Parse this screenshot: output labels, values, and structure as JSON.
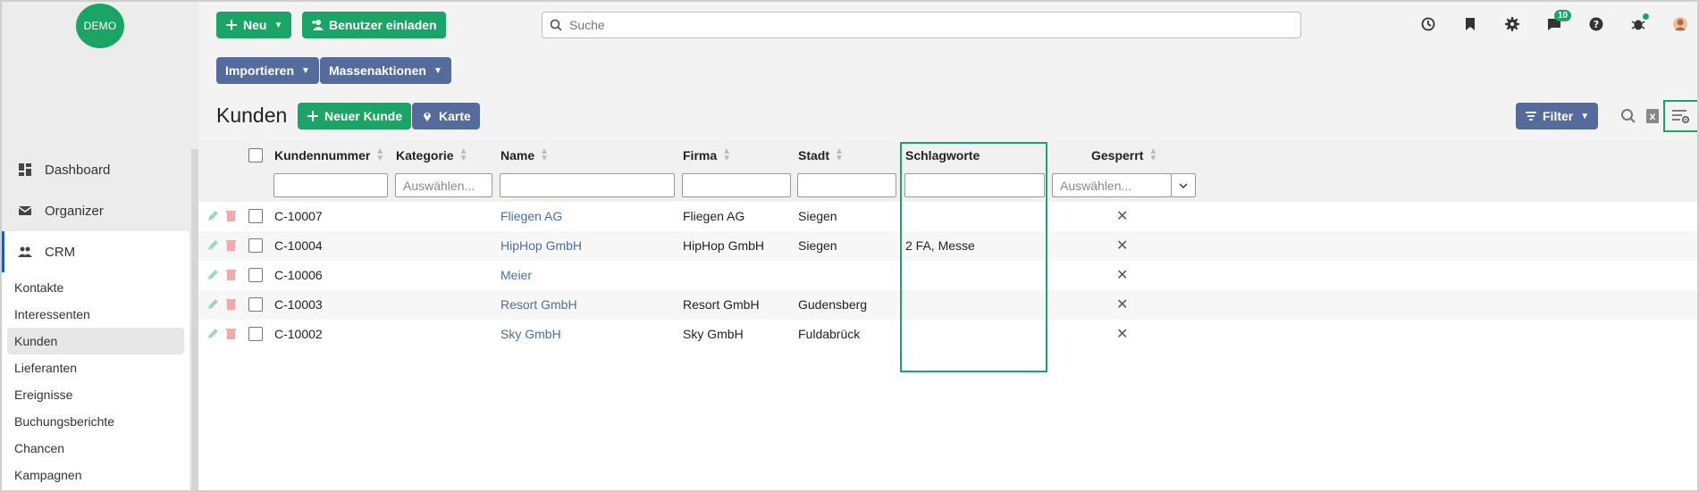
{
  "logo": "DEMO",
  "toolbar": {
    "new_label": "Neu",
    "invite_label": "Benutzer einladen",
    "import_label": "Importieren",
    "mass_label": "Massenaktionen",
    "search_placeholder": "Suche",
    "chat_badge": "10"
  },
  "sidebar": {
    "main": [
      {
        "label": "Dashboard",
        "icon": "dashboard-icon"
      },
      {
        "label": "Organizer",
        "icon": "mail-icon"
      },
      {
        "label": "CRM",
        "icon": "people-icon"
      }
    ],
    "sub": [
      "Kontakte",
      "Interessenten",
      "Kunden",
      "Lieferanten",
      "Ereignisse",
      "Buchungsberichte",
      "Chancen",
      "Kampagnen"
    ]
  },
  "page": {
    "title": "Kunden",
    "new_customer_label": "Neuer Kunde",
    "map_label": "Karte",
    "filter_label": "Filter"
  },
  "table": {
    "columns": {
      "kundennummer": "Kundennummer",
      "kategorie": "Kategorie",
      "name": "Name",
      "firma": "Firma",
      "stadt": "Stadt",
      "schlagworte": "Schlagworte",
      "gesperrt": "Gesperrt"
    },
    "kategorie_placeholder": "Auswählen...",
    "gesperrt_placeholder": "Auswählen...",
    "rows": [
      {
        "nr": "C-10007",
        "name": "Fliegen AG",
        "firma": "Fliegen AG",
        "stadt": "Siegen",
        "tags": ""
      },
      {
        "nr": "C-10004",
        "name": "HipHop GmbH",
        "firma": "HipHop GmbH",
        "stadt": "Siegen",
        "tags": "2 FA, Messe"
      },
      {
        "nr": "C-10006",
        "name": "Meier",
        "firma": "",
        "stadt": "",
        "tags": ""
      },
      {
        "nr": "C-10003",
        "name": "Resort GmbH",
        "firma": "Resort GmbH",
        "stadt": "Gudensberg",
        "tags": ""
      },
      {
        "nr": "C-10002",
        "name": "Sky GmbH",
        "firma": "Sky GmbH",
        "stadt": "Fuldabrück",
        "tags": ""
      }
    ]
  },
  "colors": {
    "green": "#1aa567",
    "slate": "#556b9c",
    "link": "#4a6fa5"
  }
}
